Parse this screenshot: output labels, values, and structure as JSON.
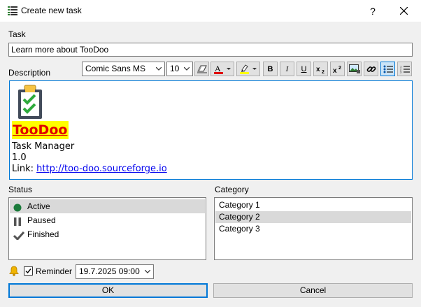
{
  "window": {
    "title": "Create new task",
    "help_glyph": "?",
    "app_icon": "task-list-icon",
    "close_icon": "close-icon"
  },
  "task": {
    "label": "Task",
    "value": "Learn more about TooDoo"
  },
  "description": {
    "label": "Description",
    "toolbar": {
      "font_family": "Comic Sans MS",
      "font_size": "10",
      "font_color": "#e00000",
      "highlight_color": "#ffff00",
      "bold": "B",
      "italic": "I",
      "underline": "U"
    },
    "content": {
      "logo_icon": "clipboard-check-icon",
      "brand": "TooDoo",
      "line1": "Task Manager",
      "line2": "1.0",
      "link_prefix": "Link: ",
      "link_text": "http://too-doo.sourceforge.io"
    }
  },
  "status": {
    "label": "Status",
    "items": [
      {
        "label": "Active",
        "icon": "active-dot-icon",
        "selected": true
      },
      {
        "label": "Paused",
        "icon": "pause-icon",
        "selected": false
      },
      {
        "label": "Finished",
        "icon": "checkmark-icon",
        "selected": false
      }
    ]
  },
  "category": {
    "label": "Category",
    "items": [
      {
        "label": "Category 1",
        "selected": false
      },
      {
        "label": "Category 2",
        "selected": true
      },
      {
        "label": "Category 3",
        "selected": false
      }
    ]
  },
  "reminder": {
    "label": "Reminder",
    "checked": true,
    "datetime": "19.7.2025 09:00"
  },
  "buttons": {
    "ok": "OK",
    "cancel": "Cancel"
  },
  "colors": {
    "accent": "#0078d7",
    "brand_text": "#e00000",
    "brand_highlight": "#ffff00",
    "active_status": "#1a7a3a",
    "link": "#0000ee"
  }
}
